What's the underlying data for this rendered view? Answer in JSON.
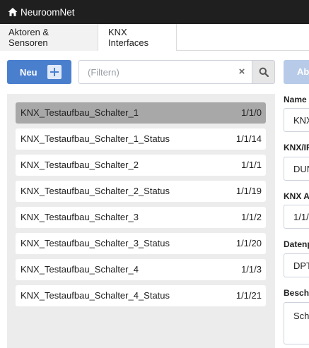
{
  "app": {
    "title": "NeuroomNet",
    "icon": "home-icon"
  },
  "tabs": [
    {
      "label": "Aktoren & Sensoren",
      "active": true
    },
    {
      "label": "KNX Interfaces",
      "active": false
    }
  ],
  "toolbar": {
    "new_label": "Neu",
    "new_icon": "plus-icon",
    "filter_placeholder": "(Filtern)",
    "clear_icon_text": "×",
    "search_icon": "search-icon",
    "abort_label": "Ab"
  },
  "list": {
    "items": [
      {
        "name": "KNX_Testaufbau_Schalter_1",
        "address": "1/1/0",
        "selected": true
      },
      {
        "name": "KNX_Testaufbau_Schalter_1_Status",
        "address": "1/1/14",
        "selected": false
      },
      {
        "name": "KNX_Testaufbau_Schalter_2",
        "address": "1/1/1",
        "selected": false
      },
      {
        "name": "KNX_Testaufbau_Schalter_2_Status",
        "address": "1/1/19",
        "selected": false
      },
      {
        "name": "KNX_Testaufbau_Schalter_3",
        "address": "1/1/2",
        "selected": false
      },
      {
        "name": "KNX_Testaufbau_Schalter_3_Status",
        "address": "1/1/20",
        "selected": false
      },
      {
        "name": "KNX_Testaufbau_Schalter_4",
        "address": "1/1/3",
        "selected": false
      },
      {
        "name": "KNX_Testaufbau_Schalter_4_Status",
        "address": "1/1/21",
        "selected": false
      }
    ]
  },
  "form": {
    "name_label": "Name d",
    "name_value": "KNX",
    "interface_label": "KNX/IP",
    "interface_value": "DUN",
    "address_label": "KNX A",
    "address_value": "1/1/",
    "datapoint_label": "Datenp",
    "datapoint_value": "DPT",
    "description_label": "Beschr",
    "description_value": "Scha"
  },
  "colors": {
    "navbar": "#1f1f1f",
    "primary": "#4a7fce",
    "primary_disabled": "#b7cbe8",
    "selected_row": "#a8a8a8",
    "panel": "#ececec"
  }
}
